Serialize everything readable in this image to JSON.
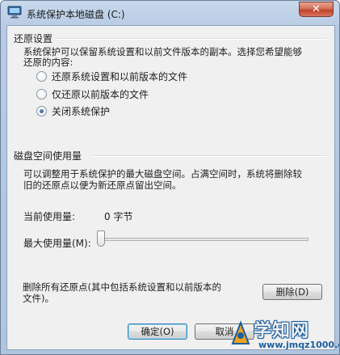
{
  "window": {
    "title": "系统保护本地磁盘 (C:)",
    "close_glyph": "✕"
  },
  "restore_settings": {
    "group_label": "还原设置",
    "description_line1": "系统保护可以保留系统设置和以前文件版本的副本。选择您希望能够",
    "description_line2": "还原的内容:",
    "options": [
      {
        "label": "还原系统设置和以前版本的文件",
        "checked": false
      },
      {
        "label": "仅还原以前版本的文件",
        "checked": false
      },
      {
        "label": "关闭系统保护",
        "checked": true
      }
    ]
  },
  "disk_usage": {
    "group_label": "磁盘空间使用量",
    "description_line1": "可以调整用于系统保护的最大磁盘空间。占满空间时，系统将删除较",
    "description_line2": "旧的还原点以便为新还原点留出空间。",
    "current_usage_label": "当前使用量:",
    "current_usage_value": "0 字节",
    "max_usage_label": "最大使用量(M):",
    "max_usage_fraction": 0
  },
  "delete_section": {
    "text_line1": "删除所有还原点(其中包括系统设置和以前版本的",
    "text_line2": "文件)。",
    "delete_button": "删除(D)"
  },
  "footer": {
    "ok_button": "确定(O)",
    "cancel_button": "取消"
  },
  "watermark": {
    "brand": "学知网",
    "url": "www.jmqz1000.com"
  }
}
